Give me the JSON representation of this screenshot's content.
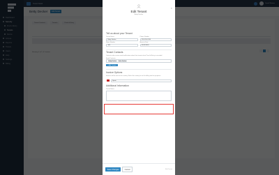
{
  "sidebar": {
    "items": [
      {
        "label": "Dashboard",
        "active": false,
        "sub": false
      },
      {
        "label": "Security",
        "active": true,
        "sub": false
      },
      {
        "label": "Proof of Entry",
        "active": false,
        "sub": true
      },
      {
        "label": "Tenants",
        "active": true,
        "sub": true
      },
      {
        "label": "Rooms",
        "active": false,
        "sub": true
      },
      {
        "label": "Access",
        "active": false,
        "sub": false
      },
      {
        "label": "Reports",
        "active": false,
        "sub": false
      },
      {
        "label": "Tickets",
        "active": false,
        "sub": false
      },
      {
        "label": "Users",
        "active": false,
        "sub": false
      },
      {
        "label": "Help",
        "active": false,
        "sub": false
      },
      {
        "label": "Settings",
        "active": false,
        "sub": false
      },
      {
        "label": "Billing",
        "active": false,
        "sub": false
      }
    ]
  },
  "topbar": {
    "breadcrumb": "Tenant Detail",
    "user": "Sarah Watson"
  },
  "page": {
    "title": "Betty Decker",
    "badge": "Edit Tenant",
    "actions": [
      "Tenant Contacts",
      "Tenants",
      "Proof of Entry"
    ],
    "foot_text": "Showing 1 to 1 of 1 entries"
  },
  "modal": {
    "title": "Edit Tenant",
    "subtitle": "Betty Decker",
    "close": "×",
    "about": {
      "title": "Tell us about your Tenant",
      "first_label": "Tenant Name",
      "first_value": "Betty Decker",
      "phone_label": "Phone Number",
      "phone_value": "555-555-1234",
      "room_label": "Room Number",
      "room_value": "104",
      "move_label": "Move-in Date",
      "move_value": "01/01/2020"
    },
    "contacts": {
      "title": "Tenant Contacts",
      "hint": "Contacts who receive email notifications about their tenant when Proof of Entry is recorded.",
      "label": "Email Contacts",
      "tags": [
        "Betty Decker",
        "John Decker"
      ],
      "add_button": "+ Add Contact"
    },
    "invoice": {
      "title": "Invoice Options",
      "hint": "Invoices will be sent to this country. Select the country to use for billing and tax purposes.",
      "country_value": "Spain"
    },
    "additional": {
      "title": "Additional Information",
      "notes_label": "Tenant Notes"
    },
    "footer": {
      "save": "Save Changes",
      "cancel": "Cancel",
      "note": "Edit Tenant"
    }
  }
}
